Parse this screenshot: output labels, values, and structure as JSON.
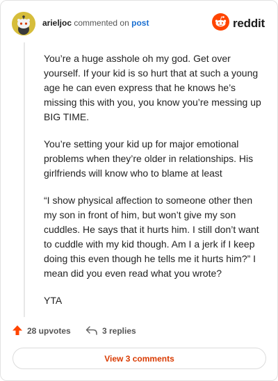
{
  "comment": {
    "username": "arieljoc",
    "action_text": "commented on",
    "post_link": "post",
    "paragraphs": [
      "You’re a huge asshole oh my god. Get over yourself. If your kid is so hurt that at such a young age he can even express that he knows he’s missing this with you, you know you’re messing up BIG TIME.",
      "You’re setting your kid up for major emotional problems when they’re older in relationships. His girlfriends will know who to blame at least",
      "“I show physical affection to someone other then my son in front of him, but won’t give my son cuddles. He says that it hurts him. I still don’t want to cuddle with my kid though. Am I a jerk if I keep doing this even though he tells me it hurts him?” I mean did you even read what you wrote?",
      "YTA"
    ]
  },
  "brand": {
    "wordmark": "reddit",
    "accent_color": "#ff4500"
  },
  "actions": {
    "upvotes_label": "28 upvotes",
    "replies_label": "3 replies",
    "view_comments_label": "View 3 comments"
  },
  "icons": {
    "avatar": "snoo-avatar-icon",
    "logo": "reddit-logo-icon",
    "upvote": "upvote-arrow-icon",
    "reply": "reply-arrow-icon"
  }
}
